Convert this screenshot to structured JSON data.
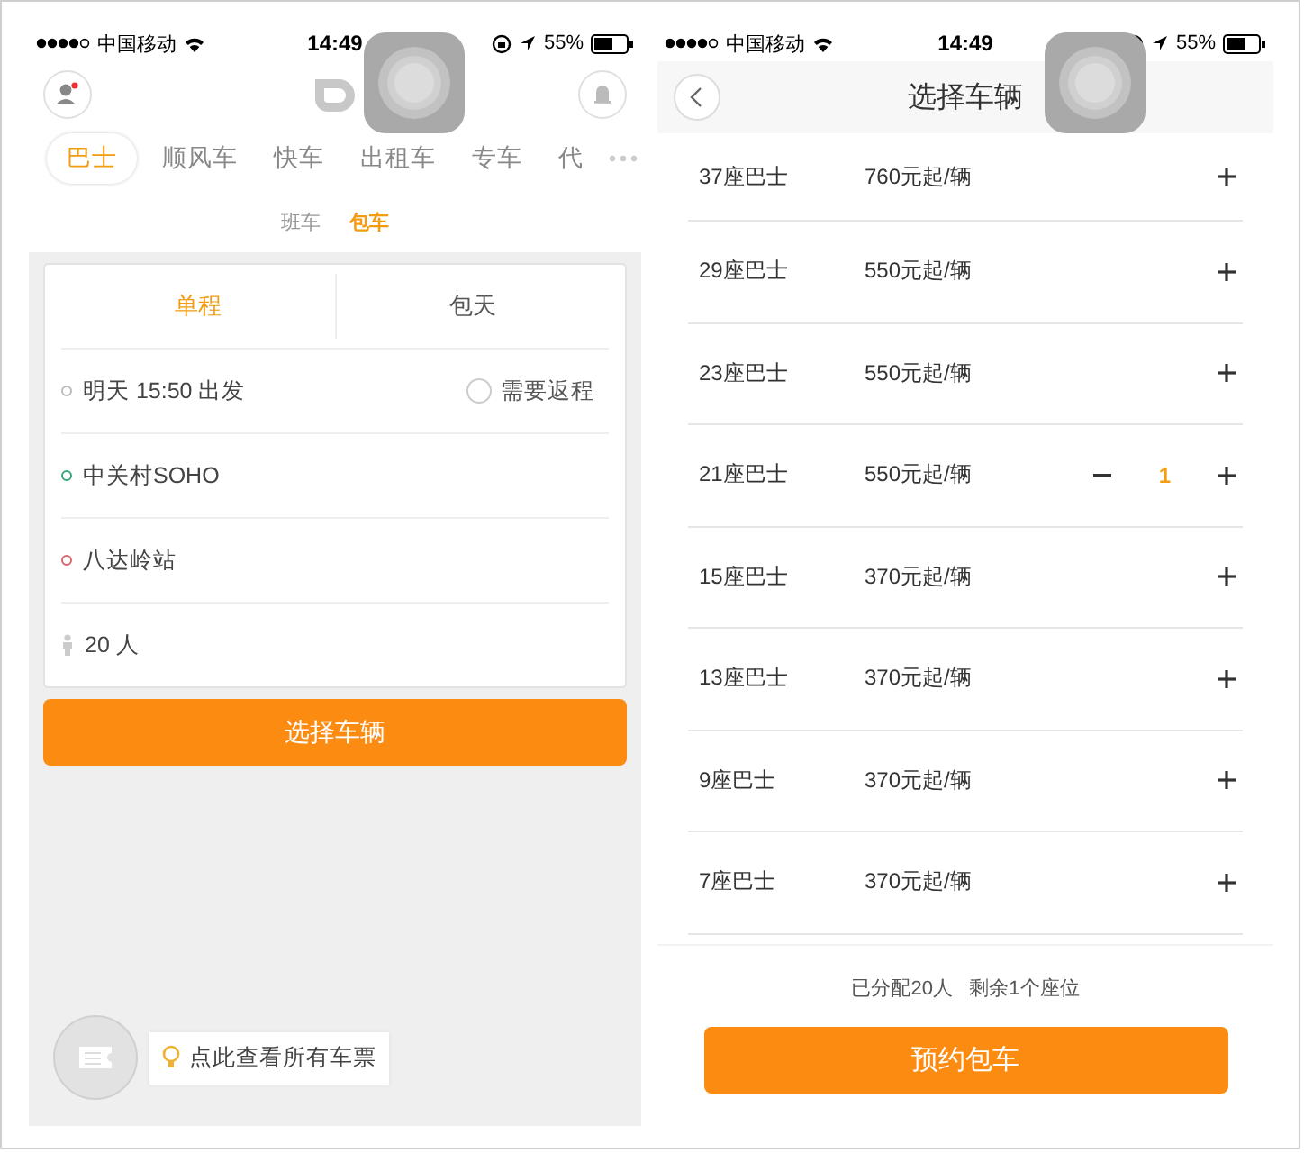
{
  "left_screen": {
    "status_bar": {
      "carrier": "中国移动",
      "time": "14:49",
      "battery": "55%"
    },
    "service_tabs": [
      {
        "label": "巴士",
        "selected": true
      },
      {
        "label": "顺风车",
        "selected": false
      },
      {
        "label": "快车",
        "selected": false
      },
      {
        "label": "出租车",
        "selected": false
      },
      {
        "label": "专车",
        "selected": false
      },
      {
        "label": "代",
        "selected": false
      }
    ],
    "sub_tabs": [
      {
        "label": "班车",
        "selected": false
      },
      {
        "label": "包车",
        "selected": true
      }
    ],
    "trip_tabs": [
      {
        "label": "单程",
        "selected": true
      },
      {
        "label": "包天",
        "selected": false
      }
    ],
    "fields": [
      {
        "kind": "dot",
        "color": "#bbbbbb",
        "text": "明天 15:50  出发",
        "option": {
          "label": "需要返程",
          "checked": false
        }
      },
      {
        "kind": "dot",
        "color": "#3aa57a",
        "text": "中关村SOHO"
      },
      {
        "kind": "dot",
        "color": "#d9646a",
        "text": "八达岭站"
      },
      {
        "kind": "person",
        "text": "20 人"
      }
    ],
    "button": "选择车辆",
    "tooltip": "点此查看所有车票"
  },
  "right_screen": {
    "status_bar": {
      "carrier": "中国移动",
      "time": "14:49",
      "battery": "55%"
    },
    "title": "选择车辆",
    "vehicles": [
      {
        "name": "37座巴士",
        "price": "760元起/辆"
      },
      {
        "name": "29座巴士",
        "price": "550元起/辆"
      },
      {
        "name": "23座巴士",
        "price": "550元起/辆"
      },
      {
        "name": "21座巴士",
        "price": "550元起/辆",
        "quantity": "1"
      },
      {
        "name": "15座巴士",
        "price": "370元起/辆"
      },
      {
        "name": "13座巴士",
        "price": "370元起/辆"
      },
      {
        "name": "9座巴士",
        "price": "370元起/辆"
      },
      {
        "name": "7座巴士",
        "price": "370元起/辆"
      }
    ],
    "summary": "已分配20人   剩余1个座位",
    "button": "预约包车"
  }
}
